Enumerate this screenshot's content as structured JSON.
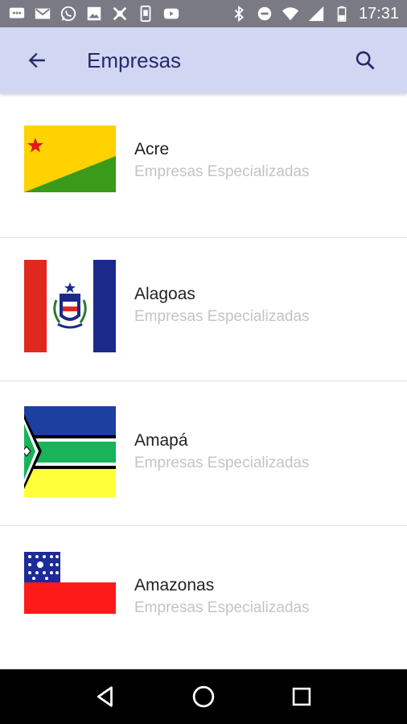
{
  "status_bar": {
    "time": "17:31",
    "left_icons": [
      "message-icon",
      "gmail-icon",
      "whatsapp-icon",
      "image-icon",
      "tool-icon",
      "phone-icon",
      "youtube-icon"
    ],
    "right_icons": [
      "bluetooth-icon",
      "dnd-icon",
      "wifi-icon",
      "signal-icon",
      "battery-icon"
    ]
  },
  "app_bar": {
    "title": "Empresas",
    "back_icon": "arrow-back-icon",
    "search_icon": "search-icon",
    "background": "#d1d6f3",
    "title_color": "#262a6b"
  },
  "list": {
    "items": [
      {
        "name": "Acre",
        "subtitle": "Empresas Especializadas",
        "flag": "acre-flag"
      },
      {
        "name": "Alagoas",
        "subtitle": "Empresas Especializadas",
        "flag": "alagoas-flag"
      },
      {
        "name": "Amapá",
        "subtitle": "Empresas Especializadas",
        "flag": "amapa-flag"
      },
      {
        "name": "Amazonas",
        "subtitle": "Empresas Especializadas",
        "flag": "amazonas-flag"
      }
    ]
  },
  "nav_bar": {
    "buttons": [
      "back-triangle-icon",
      "home-circle-icon",
      "recents-square-icon"
    ]
  }
}
